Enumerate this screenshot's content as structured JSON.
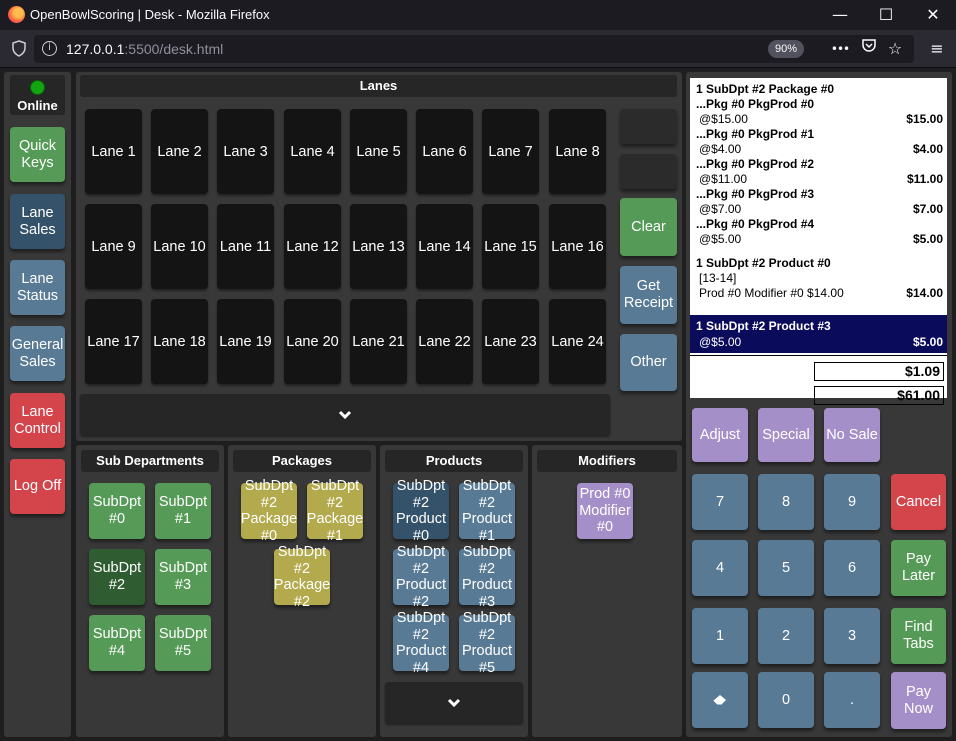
{
  "window": {
    "title": "OpenBowlScoring | Desk - Mozilla Firefox",
    "minimize": "—",
    "maximize": "☐",
    "close": "✕"
  },
  "navbar": {
    "url_host": "127.0.0.1",
    "url_rest": ":5500/desk.html",
    "zoom": "90%",
    "more": "•••"
  },
  "status": {
    "label": "Online",
    "color": "#11a611"
  },
  "sidebar": [
    {
      "label": "Quick\nKeys",
      "color": "green"
    },
    {
      "label": "Lane\nSales",
      "color": "blue-dark"
    },
    {
      "label": "Lane\nStatus",
      "color": "blue"
    },
    {
      "label": "General\nSales",
      "color": "blue"
    },
    {
      "label": "Lane\nControl",
      "color": "red"
    },
    {
      "label": "Log Off",
      "color": "red"
    }
  ],
  "lanes": {
    "title": "Lanes",
    "items": [
      "Lane 1",
      "Lane 2",
      "Lane 3",
      "Lane 4",
      "Lane 5",
      "Lane 6",
      "Lane 7",
      "Lane 8",
      "Lane 9",
      "Lane 10",
      "Lane 11",
      "Lane 12",
      "Lane 13",
      "Lane 14",
      "Lane 15",
      "Lane 16",
      "Lane 17",
      "Lane 18",
      "Lane 19",
      "Lane 20",
      "Lane 21",
      "Lane 22",
      "Lane 23",
      "Lane 24"
    ],
    "more_icon": "⌄"
  },
  "lane_actions": {
    "clear": "Clear",
    "get_receipt": "Get\nReceipt",
    "other": "Other"
  },
  "subdepartments": {
    "title": "Sub Departments",
    "items": [
      "SubDpt\n#0",
      "SubDpt\n#1",
      "SubDpt\n#2",
      "SubDpt\n#3",
      "SubDpt\n#4",
      "SubDpt\n#5"
    ]
  },
  "packages": {
    "title": "Packages",
    "items": [
      "SubDpt\n#2\nPackage\n#0",
      "SubDpt\n#2\nPackage\n#1",
      "SubDpt\n#2\nPackage\n#2"
    ]
  },
  "products": {
    "title": "Products",
    "items": [
      "SubDpt\n#2\nProduct\n#0",
      "SubDpt\n#2\nProduct\n#1",
      "SubDpt\n#2\nProduct\n#2",
      "SubDpt\n#2\nProduct\n#3",
      "SubDpt\n#2\nProduct\n#4",
      "SubDpt\n#2\nProduct\n#5"
    ],
    "more_icon": "⌄"
  },
  "modifiers": {
    "title": "Modifiers",
    "items": [
      "Prod #0\nModifier\n#0"
    ]
  },
  "receipt": {
    "lines": [
      {
        "text": "1 SubDpt #2 Package #0",
        "bold": true,
        "amount": ""
      },
      {
        "text": "...Pkg #0 PkgProd #0",
        "bold": true,
        "amount": ""
      },
      {
        "text": "@$15.00",
        "bold": false,
        "amount": "$15.00"
      },
      {
        "text": "...Pkg #0 PkgProd #1",
        "bold": true,
        "amount": ""
      },
      {
        "text": "@$4.00",
        "bold": false,
        "amount": "$4.00"
      },
      {
        "text": "...Pkg #0 PkgProd #2",
        "bold": true,
        "amount": ""
      },
      {
        "text": "@$11.00",
        "bold": false,
        "amount": "$11.00"
      },
      {
        "text": "...Pkg #0 PkgProd #3",
        "bold": true,
        "amount": ""
      },
      {
        "text": "@$7.00",
        "bold": false,
        "amount": "$7.00"
      },
      {
        "text": "...Pkg #0 PkgProd #4",
        "bold": true,
        "amount": ""
      },
      {
        "text": "@$5.00",
        "bold": false,
        "amount": "$5.00"
      },
      {
        "text": "1 SubDpt #2 Product #0",
        "bold": true,
        "amount": ""
      },
      {
        "text": "[13-14]",
        "bold": false,
        "amount": ""
      },
      {
        "text": "Prod #0 Modifier #0 $14.00",
        "bold": false,
        "amount": "$14.00"
      }
    ],
    "selected": {
      "text": "1 SubDpt #2 Product #3",
      "sub": "@$5.00",
      "amount": "$5.00"
    },
    "tax": "$1.09",
    "total": "$61.00"
  },
  "keypad": {
    "adjust": "Adjust",
    "special": "Special",
    "no_sale": "No Sale",
    "keys": [
      "7",
      "8",
      "9",
      "4",
      "5",
      "6",
      "1",
      "2",
      "3",
      "⌫",
      "0",
      "."
    ],
    "cancel": "Cancel",
    "pay_later": "Pay\nLater",
    "find_tabs": "Find\nTabs",
    "pay_now": "Pay\nNow"
  }
}
